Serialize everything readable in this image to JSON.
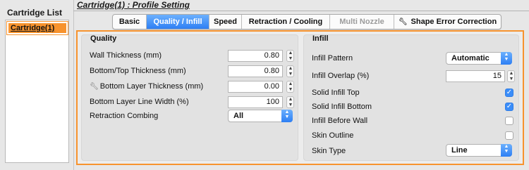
{
  "cartridge_list": {
    "title": "Cartridge List",
    "items": [
      {
        "label": "Cartridge(1)",
        "selected": true
      }
    ]
  },
  "header": {
    "title": "Cartridge(1) : Profile Setting"
  },
  "tabs": [
    {
      "label": "Basic",
      "active": false,
      "enabled": true
    },
    {
      "label": "Quality / Infill",
      "active": true,
      "enabled": true
    },
    {
      "label": "Speed",
      "active": false,
      "enabled": true
    },
    {
      "label": "Retraction / Cooling",
      "active": false,
      "enabled": true
    },
    {
      "label": "Multi Nozzle",
      "active": false,
      "enabled": false
    },
    {
      "label": "Shape Error Correction",
      "active": false,
      "enabled": true,
      "icon": "wrench-icon"
    }
  ],
  "quality": {
    "title": "Quality",
    "wall_thickness": {
      "label": "Wall Thickness (mm)",
      "value": "0.80"
    },
    "bottom_top_thickness": {
      "label": "Bottom/Top Thickness (mm)",
      "value": "0.80"
    },
    "bottom_layer_thickness": {
      "label": "Bottom Layer Thickness (mm)",
      "value": "0.00",
      "icon": "wrench-icon"
    },
    "bottom_layer_line_width": {
      "label": "Bottom Layer Line Width (%)",
      "value": "100"
    },
    "retraction_combing": {
      "label": "Retraction Combing",
      "value": "All"
    }
  },
  "infill": {
    "title": "Infill",
    "infill_pattern": {
      "label": "Infill Pattern",
      "value": "Automatic"
    },
    "infill_overlap": {
      "label": "Infill Overlap (%)",
      "value": "15"
    },
    "solid_infill_top": {
      "label": "Solid Infill Top",
      "checked": true
    },
    "solid_infill_bottom": {
      "label": "Solid Infill Bottom",
      "checked": true
    },
    "infill_before_wall": {
      "label": "Infill Before Wall",
      "checked": false
    },
    "skin_outline": {
      "label": "Skin Outline",
      "checked": false
    },
    "skin_type": {
      "label": "Skin Type",
      "value": "Line"
    }
  },
  "colors": {
    "accent_orange": "#f7932e",
    "active_blue": "#2d7ff4",
    "check_blue": "#3b8df8"
  }
}
